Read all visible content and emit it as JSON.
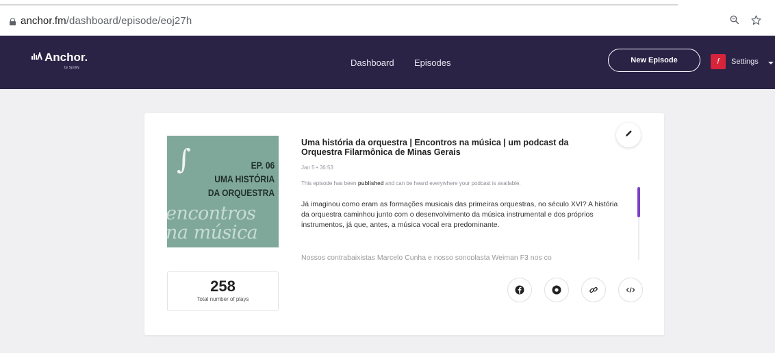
{
  "browser": {
    "url_host": "anchor.fm",
    "url_path": "/dashboard/episode/eoj27h",
    "icons": [
      "lock-icon",
      "zoom-icon",
      "star-icon"
    ]
  },
  "navbar": {
    "logo_text": "Anchor.",
    "logo_sub": "by Spotify",
    "links": [
      "Dashboard",
      "Episodes"
    ],
    "new_episode_label": "New Episode",
    "settings_label": "Settings",
    "avatar_glyph": "f",
    "colors": {
      "background": "#2a2346",
      "text": "#ffffff",
      "avatar": "#d7243a"
    }
  },
  "episode": {
    "cover": {
      "ep_number": "EP. 06",
      "line1": "UMA HISTÓRIA",
      "line2": "DA ORQUESTRA",
      "script1": "encontros",
      "script2": "na música",
      "background": "#80a89a"
    },
    "plays_count": "258",
    "plays_label": "Total number of plays",
    "title": "Uma história da orquestra | Encontros na música | um podcast da Orquestra Filarmônica de Minas Gerais",
    "meta": "Jan 5 • 36:53",
    "status_pre": "This episode has been ",
    "status_bold": "published",
    "status_post": " and can be heard everywhere your podcast is available.",
    "description": "Já imaginou como eram as formações musicais das primeiras orquestras, no século XVI? A história da orquestra caminhou junto com o desenvolvimento da música instrumental e dos próprios instrumentos, já que, antes, a música vocal era predominante.",
    "description_more": "Nossos contrabaixistas Marcelo Cunha e nosso sonoplasta Weiman F3 nos co",
    "share_icons": [
      "facebook-icon",
      "twitter-icon",
      "link-icon",
      "embed-icon"
    ],
    "accent_color": "#7a3fc7"
  }
}
